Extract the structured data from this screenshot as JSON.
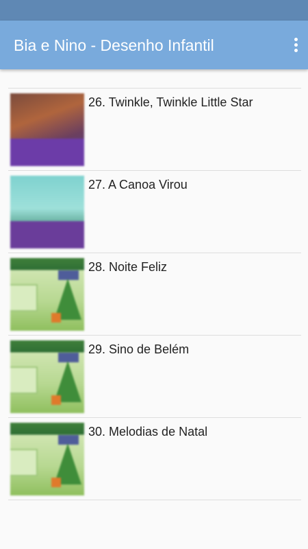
{
  "app_bar": {
    "title": "Bia e Nino - Desenho Infantil",
    "overflow_icon": "more-vertical-icon"
  },
  "list": {
    "items": [
      {
        "label": "26. Twinkle, Twinkle Little Star",
        "thumbnail_icon": "video-thumbnail"
      },
      {
        "label": "27. A Canoa Virou",
        "thumbnail_icon": "video-thumbnail"
      },
      {
        "label": "28. Noite Feliz",
        "thumbnail_icon": "video-thumbnail"
      },
      {
        "label": "29. Sino de Belém",
        "thumbnail_icon": "video-thumbnail"
      },
      {
        "label": "30. Melodias de Natal",
        "thumbnail_icon": "video-thumbnail"
      }
    ]
  },
  "colors": {
    "status_bar": "#5f88b4",
    "app_bar": "#79aadc",
    "background": "#fafafa",
    "divider": "#dddddd"
  }
}
